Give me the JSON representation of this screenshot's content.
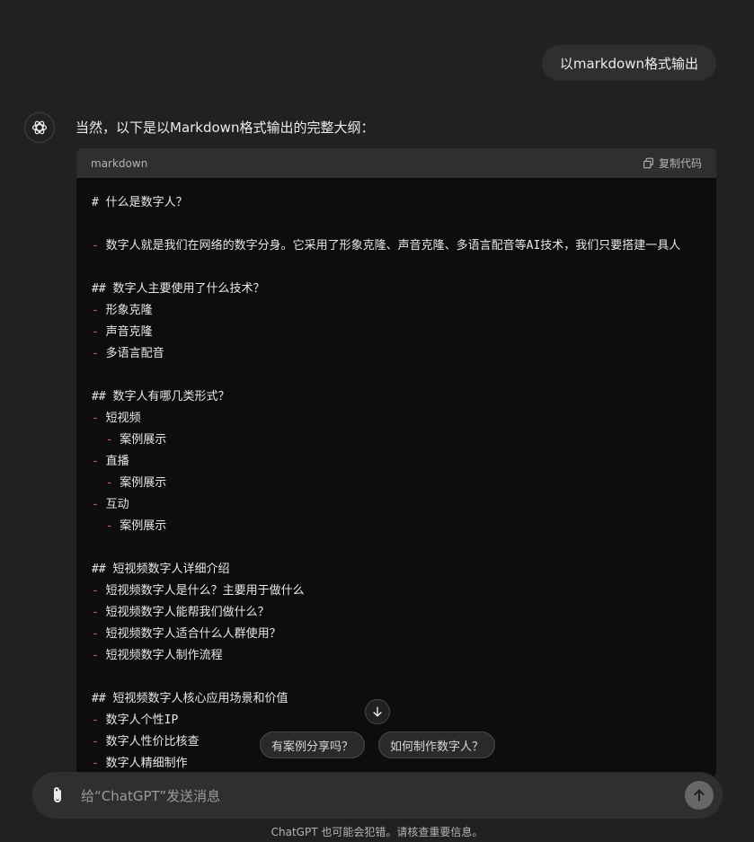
{
  "user_message": "以markdown格式输出",
  "assistant": {
    "intro": "当然，以下是以Markdown格式输出的完整大纲：",
    "code_block": {
      "language": "markdown",
      "copy_label": "复制代码",
      "lines": [
        {
          "indent": "",
          "marker": "",
          "text": "# 什么是数字人？"
        },
        {
          "indent": "",
          "marker": "",
          "text": ""
        },
        {
          "indent": "",
          "marker": "-",
          "text": " 数字人就是我们在网络的数字分身。它采用了形象克隆、声音克隆、多语言配音等AI技术，我们只要搭建一具人"
        },
        {
          "indent": "",
          "marker": "",
          "text": ""
        },
        {
          "indent": "",
          "marker": "",
          "text": "## 数字人主要使用了什么技术？"
        },
        {
          "indent": "",
          "marker": "-",
          "text": " 形象克隆"
        },
        {
          "indent": "",
          "marker": "-",
          "text": " 声音克隆"
        },
        {
          "indent": "",
          "marker": "-",
          "text": " 多语言配音"
        },
        {
          "indent": "",
          "marker": "",
          "text": ""
        },
        {
          "indent": "",
          "marker": "",
          "text": "## 数字人有哪几类形式？"
        },
        {
          "indent": "",
          "marker": "-",
          "text": " 短视频"
        },
        {
          "indent": "  ",
          "marker": "-",
          "text": " 案例展示"
        },
        {
          "indent": "",
          "marker": "-",
          "text": " 直播"
        },
        {
          "indent": "  ",
          "marker": "-",
          "text": " 案例展示"
        },
        {
          "indent": "",
          "marker": "-",
          "text": " 互动"
        },
        {
          "indent": "  ",
          "marker": "-",
          "text": " 案例展示"
        },
        {
          "indent": "",
          "marker": "",
          "text": ""
        },
        {
          "indent": "",
          "marker": "",
          "text": "## 短视频数字人详细介绍"
        },
        {
          "indent": "",
          "marker": "-",
          "text": " 短视频数字人是什么？主要用于做什么"
        },
        {
          "indent": "",
          "marker": "-",
          "text": " 短视频数字人能帮我们做什么？"
        },
        {
          "indent": "",
          "marker": "-",
          "text": " 短视频数字人适合什么人群使用？"
        },
        {
          "indent": "",
          "marker": "-",
          "text": " 短视频数字人制作流程"
        },
        {
          "indent": "",
          "marker": "",
          "text": ""
        },
        {
          "indent": "",
          "marker": "",
          "text": "## 短视频数字人核心应用场景和价值"
        },
        {
          "indent": "",
          "marker": "-",
          "text": " 数字人个性IP"
        },
        {
          "indent": "",
          "marker": "-",
          "text": " 数字人性价比核查"
        },
        {
          "indent": "",
          "marker": "-",
          "text": " 数字人精细制作"
        }
      ]
    }
  },
  "suggestions": [
    "有案例分享吗？",
    "如何制作数字人？"
  ],
  "composer": {
    "placeholder": "给“ChatGPT”发送消息"
  },
  "footer_note": "ChatGPT 也可能会犯错。请核查重要信息。",
  "icons": {
    "avatar": "openai-logo-icon",
    "copy": "copy-icon",
    "scroll": "arrow-down-icon",
    "attach": "paperclip-icon",
    "send": "arrow-up-icon"
  },
  "colors": {
    "background": "#212121",
    "bubble": "#2f2f2f",
    "code_bg": "#0d0d0d",
    "markdown_dash": "#e0605a",
    "send_button": "#676767"
  }
}
